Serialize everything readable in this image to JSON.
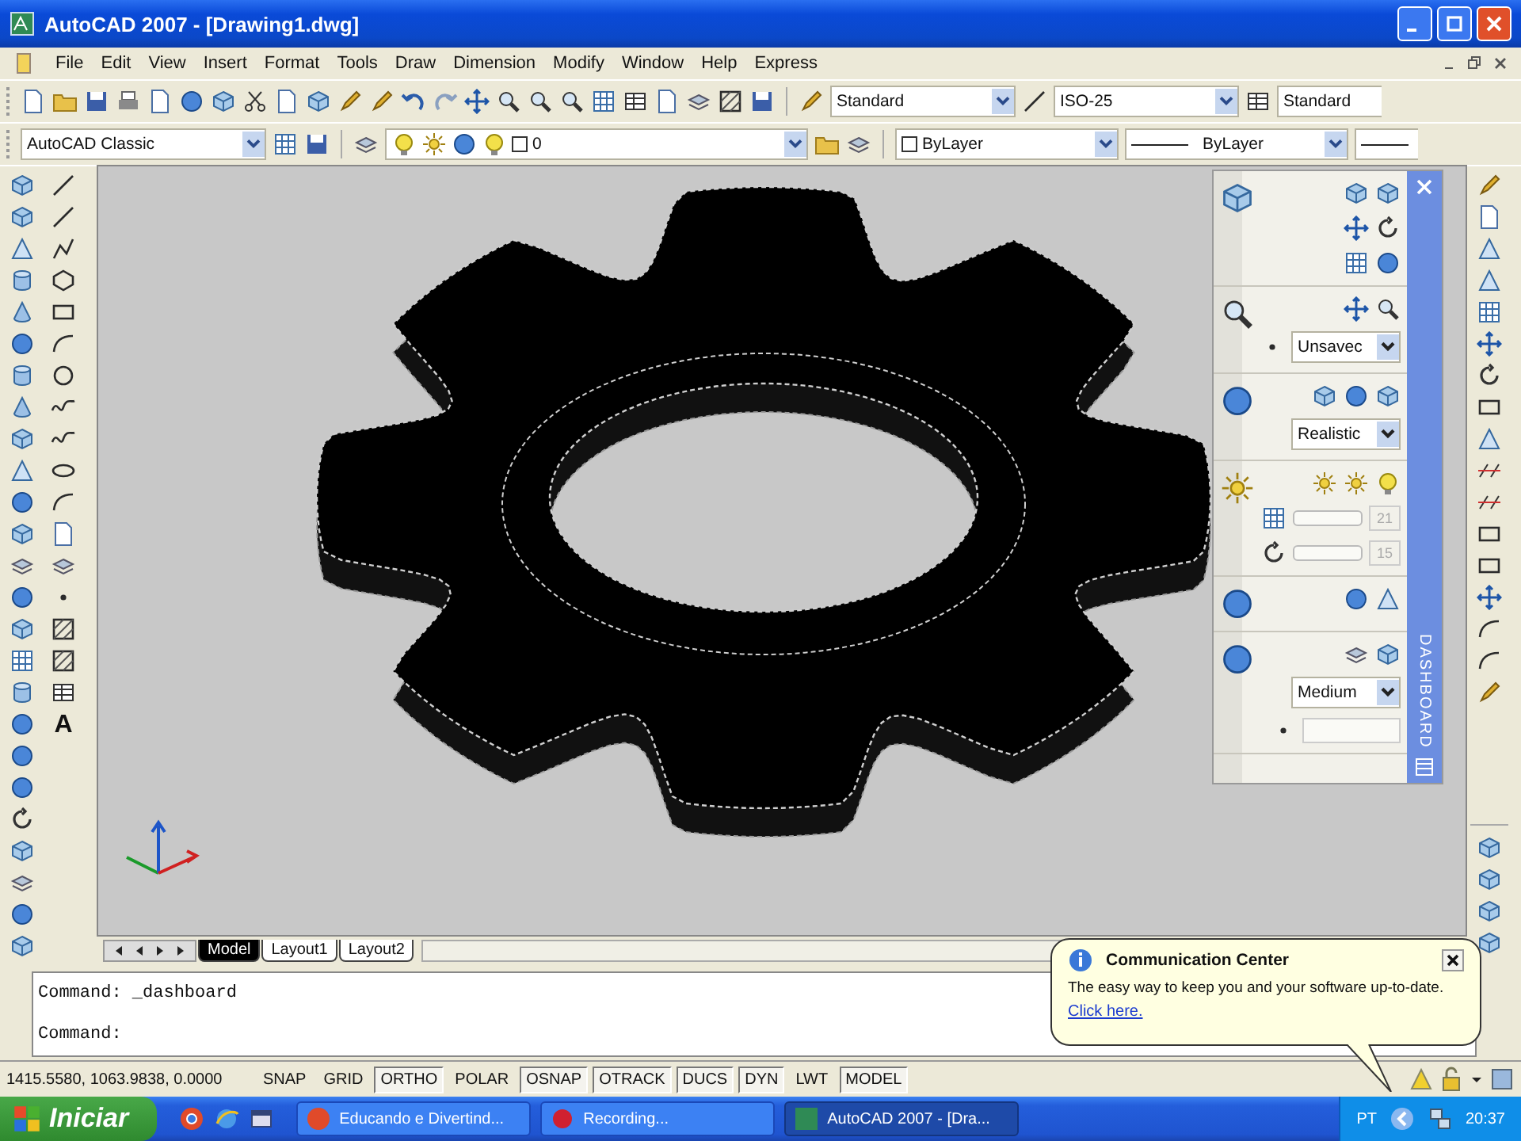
{
  "window": {
    "title": "AutoCAD 2007 - [Drawing1.dwg]"
  },
  "menu": [
    "File",
    "Edit",
    "View",
    "Insert",
    "Format",
    "Tools",
    "Draw",
    "Dimension",
    "Modify",
    "Window",
    "Help",
    "Express"
  ],
  "styles_toolbar": {
    "text_style": "Standard",
    "dim_style": "ISO-25",
    "table_style": "Standard"
  },
  "workspace": "AutoCAD Classic",
  "layer": "0",
  "properties": {
    "color_setting": "ByLayer",
    "linetype": "ByLayer"
  },
  "draw_toolbar": {
    "text_tool": "A"
  },
  "dashboard": {
    "title": "DASHBOARD",
    "named_view": "Unsavec",
    "visual_style": "Realistic",
    "light_values": [
      "21",
      "15"
    ],
    "render_quality": "Medium"
  },
  "layout_tabs": [
    {
      "label": "Model",
      "selected": true
    },
    {
      "label": "Layout1",
      "selected": false
    },
    {
      "label": "Layout2",
      "selected": false
    }
  ],
  "command_lines": [
    "Command: _dashboard",
    "Command:"
  ],
  "status": {
    "coordinates": "1415.5580, 1063.9838, 0.0000",
    "toggles": [
      {
        "label": "SNAP",
        "on": false
      },
      {
        "label": "GRID",
        "on": false
      },
      {
        "label": "ORTHO",
        "on": true
      },
      {
        "label": "POLAR",
        "on": false
      },
      {
        "label": "OSNAP",
        "on": true
      },
      {
        "label": "OTRACK",
        "on": true
      },
      {
        "label": "DUCS",
        "on": true
      },
      {
        "label": "DYN",
        "on": true
      },
      {
        "label": "LWT",
        "on": false
      }
    ],
    "space": "MODEL"
  },
  "balloon": {
    "title": "Communication Center",
    "message": "The easy way to keep you and your software up-to-date.",
    "link": "Click here."
  },
  "taskbar": {
    "start": "Iniciar",
    "tasks": [
      {
        "label": "Educando e Divertind...",
        "selected": false
      },
      {
        "label": "Recording...",
        "selected": false
      },
      {
        "label": "AutoCAD 2007 - [Dra...",
        "selected": true
      }
    ],
    "language": "PT",
    "clock": "20:37"
  }
}
